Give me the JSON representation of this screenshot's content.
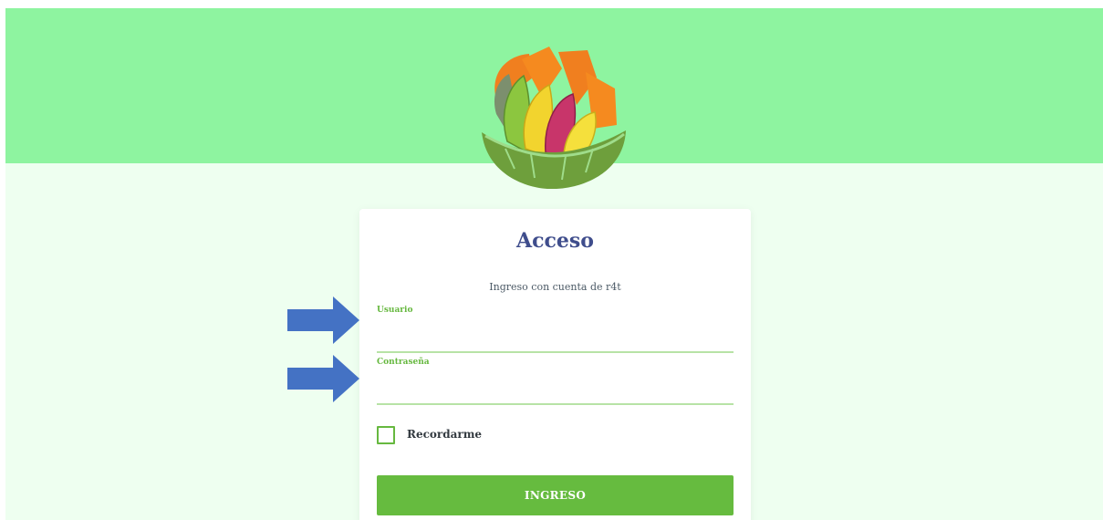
{
  "login": {
    "title": "Acceso",
    "subtitle": "Ingreso con cuenta de r4t",
    "username": {
      "label": "Usuario",
      "value": ""
    },
    "password": {
      "label": "Contraseña",
      "value": ""
    },
    "remember": {
      "label": "Recordarme",
      "checked": false
    },
    "submit_label": "INGRESO"
  },
  "colors": {
    "hero_bg": "#8ef4a0",
    "page_bg": "#eefff0",
    "accent_green": "#66bb3f",
    "title_blue": "#3f4d8c",
    "annotation_arrow": "#4472c4"
  },
  "icons": {
    "logo": "fruit-leaf-bowl-logo",
    "annotation": "arrow-right-icon"
  }
}
